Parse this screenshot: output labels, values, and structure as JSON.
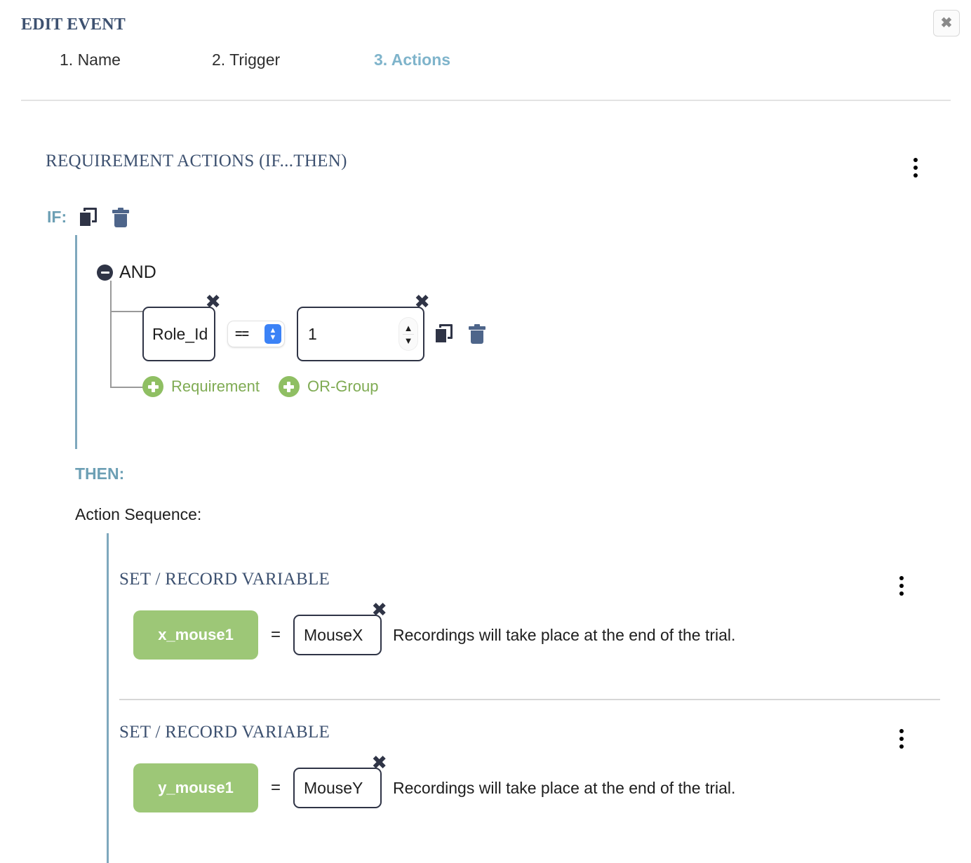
{
  "header": {
    "title": "EDIT EVENT",
    "close_label": "✖",
    "close_icon": "close-icon",
    "tabs": [
      {
        "label": "1. Name",
        "active": false
      },
      {
        "label": "2. Trigger",
        "active": false
      },
      {
        "label": "3. Actions",
        "active": true
      }
    ]
  },
  "requirement_section": {
    "title": "REQUIREMENT ACTIONS (IF...THEN)",
    "menu_icon": "kebab-menu-icon",
    "if_label": "IF:",
    "copy_icon": "copy-icon",
    "delete_icon": "trash-icon",
    "logic_group": {
      "toggle_icon": "minus-circle-icon",
      "operator": "AND",
      "condition": {
        "variable": "Role_Id",
        "operator": "==",
        "operator_options": [
          "==",
          "!=",
          "<",
          ">",
          "<=",
          ">="
        ],
        "value": "1",
        "remove_icon": "close-x-icon",
        "copy_icon": "copy-icon",
        "delete_icon": "trash-icon"
      },
      "add_buttons": [
        {
          "label": "Requirement",
          "icon": "plus-circle-icon"
        },
        {
          "label": "OR-Group",
          "icon": "plus-circle-icon"
        }
      ]
    },
    "then_label": "THEN:",
    "action_sequence_label": "Action Sequence:",
    "actions": [
      {
        "title": "SET / RECORD VARIABLE",
        "menu_icon": "kebab-menu-icon",
        "variable": "x_mouse1",
        "equals": "=",
        "value": "MouseX",
        "remove_icon": "close-x-icon",
        "note": "Recordings will take place at the end of the trial."
      },
      {
        "title": "SET / RECORD VARIABLE",
        "menu_icon": "kebab-menu-icon",
        "variable": "y_mouse1",
        "equals": "=",
        "value": "MouseY",
        "remove_icon": "close-x-icon",
        "note": "Recordings will take place at the end of the trial."
      }
    ]
  },
  "colors": {
    "heading": "#3d5170",
    "accent_teal": "#6c9fb4",
    "active_tab": "#7fb4cb",
    "green": "#8fbf63",
    "green_pill": "#9dc777",
    "dark": "#2f3446",
    "trash_blue": "#4e658a",
    "select_blue": "#3b82f6",
    "rail": "#7fa8bd"
  }
}
